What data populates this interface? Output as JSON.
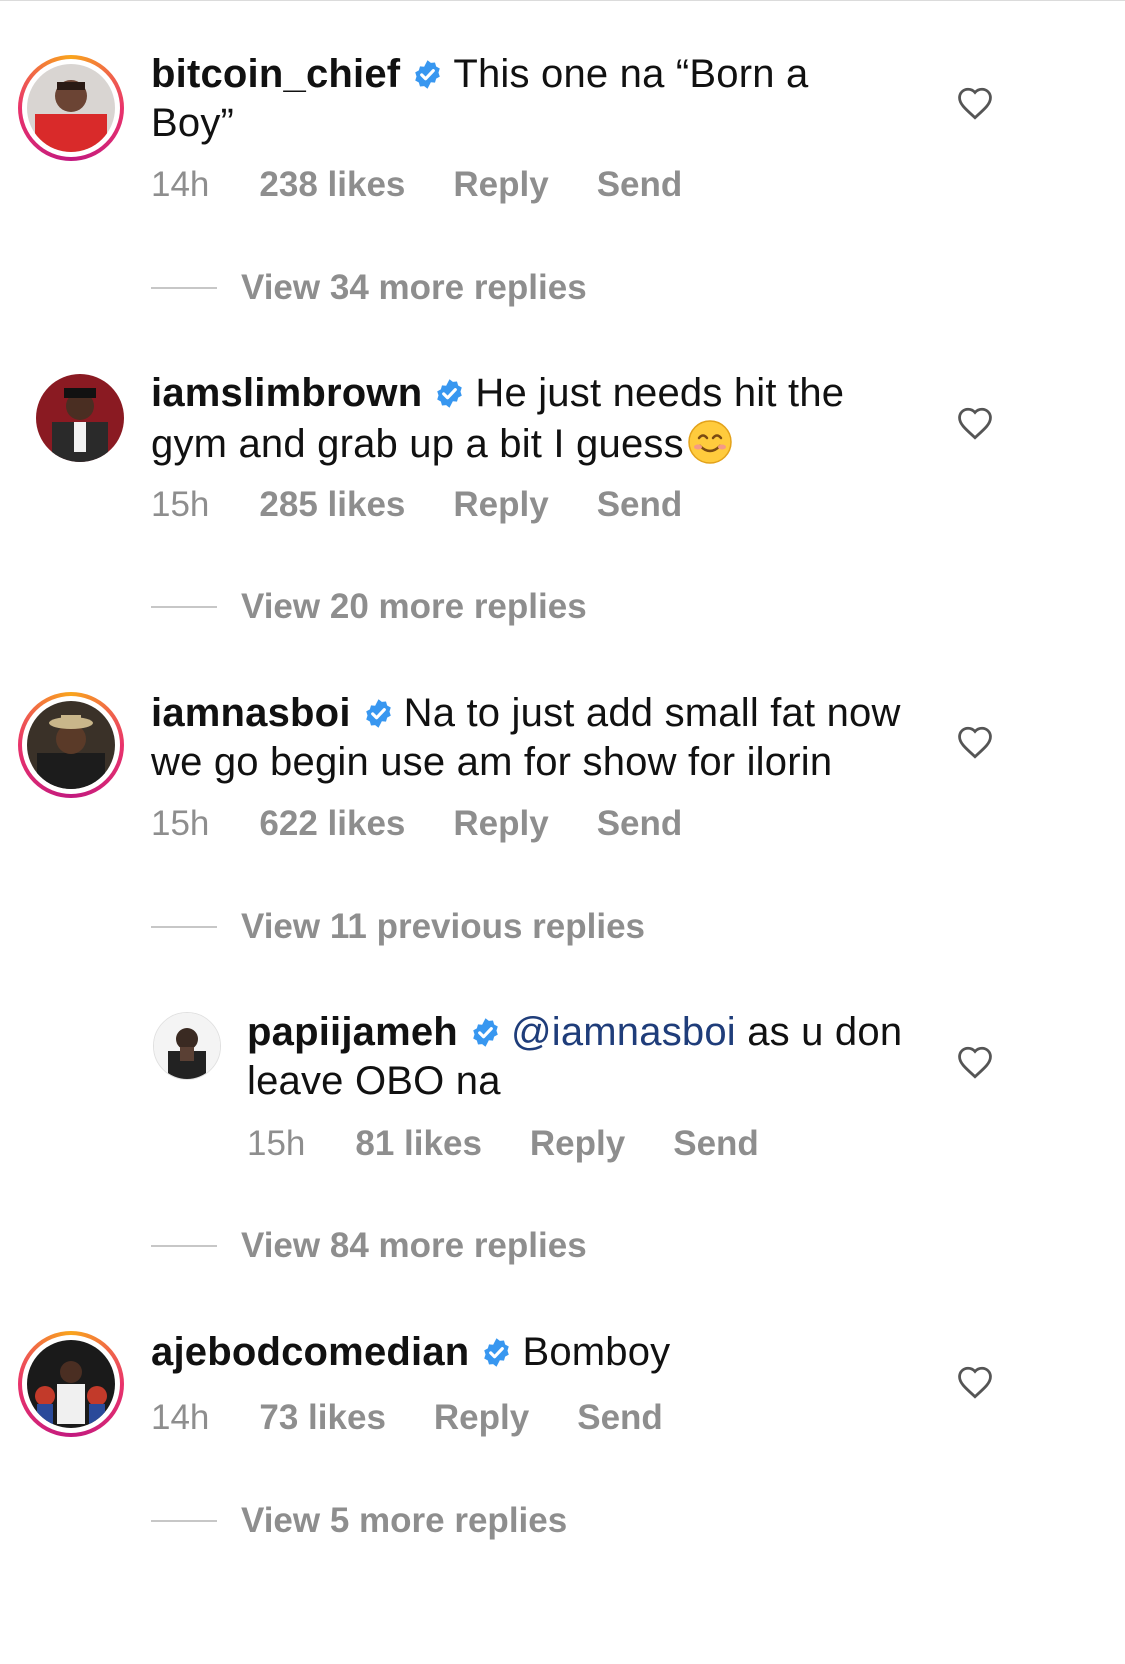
{
  "comments": [
    {
      "username": "bitcoin_chief",
      "text_line1": "This one na “Born a",
      "text_line2": "Boy”",
      "time": "14h",
      "likes": "238 likes",
      "reply": "Reply",
      "send": "Send",
      "view_replies": "View 34 more replies"
    },
    {
      "username": "iamslimbrown",
      "text_line1": "He just needs hit the",
      "text_line2": "gym and grab up a bit I guess",
      "emoji": "smiling-face-emoji",
      "time": "15h",
      "likes": "285 likes",
      "reply": "Reply",
      "send": "Send",
      "view_replies": "View 20 more replies"
    },
    {
      "username": "iamnasboi",
      "text_line1": "Na to just add small fat now",
      "text_line2": "we go begin use am for show for ilorin",
      "time": "15h",
      "likes": "622 likes",
      "reply": "Reply",
      "send": "Send",
      "view_replies": "View 11 previous replies"
    },
    {
      "username": "papiijameh",
      "mention": "@iamnasboi",
      "text_line1": " as u don",
      "text_line2": "leave OBO na",
      "time": "15h",
      "likes": "81 likes",
      "reply": "Reply",
      "send": "Send",
      "view_replies": "View 84 more replies"
    },
    {
      "username": "ajebodcomedian",
      "text_line1": "Bomboy",
      "time": "14h",
      "likes": "73 likes",
      "reply": "Reply",
      "send": "Send",
      "view_replies": "View 5 more replies"
    }
  ],
  "colors": {
    "verified": "#3897f0",
    "meta_gray": "#8e8e8e",
    "mention": "#1f3d7a"
  },
  "icons": [
    "verified-badge-icon",
    "heart-icon",
    "smiling-face-emoji"
  ]
}
